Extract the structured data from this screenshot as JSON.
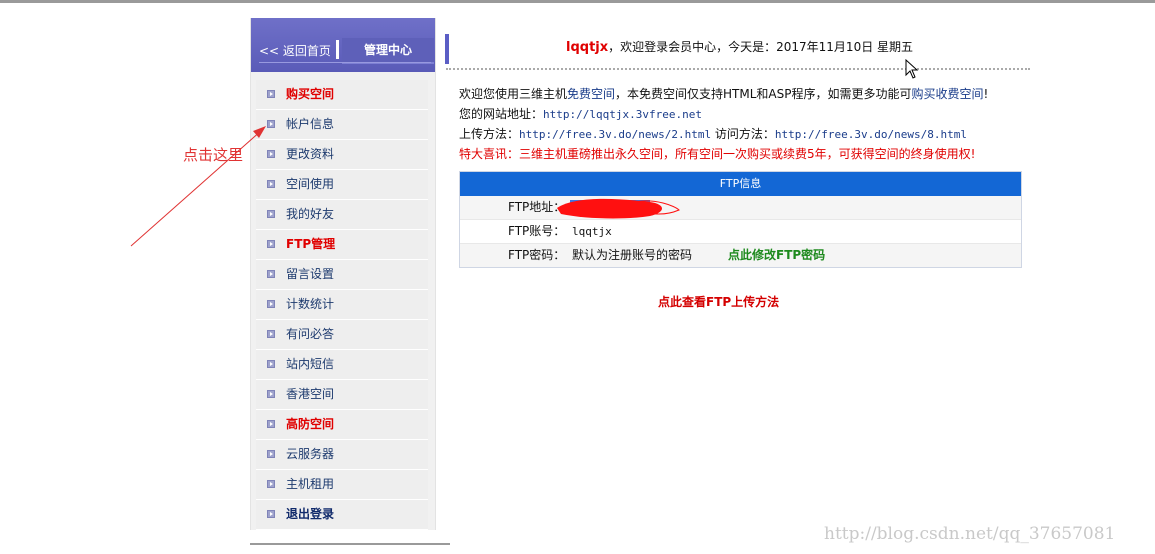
{
  "sidebar": {
    "back_label": "<< 返回首页",
    "title": "管理中心",
    "items": [
      {
        "label": "购买空间",
        "style": "red"
      },
      {
        "label": "帐户信息",
        "style": "normal"
      },
      {
        "label": "更改资料",
        "style": "normal"
      },
      {
        "label": "空间使用",
        "style": "normal"
      },
      {
        "label": "我的好友",
        "style": "normal"
      },
      {
        "label": "FTP管理",
        "style": "red"
      },
      {
        "label": "留言设置",
        "style": "normal"
      },
      {
        "label": "计数统计",
        "style": "normal"
      },
      {
        "label": "有问必答",
        "style": "normal"
      },
      {
        "label": "站内短信",
        "style": "normal"
      },
      {
        "label": "香港空间",
        "style": "normal"
      },
      {
        "label": "高防空间",
        "style": "red"
      },
      {
        "label": "云服务器",
        "style": "normal"
      },
      {
        "label": "主机租用",
        "style": "normal"
      },
      {
        "label": "退出登录",
        "style": "navy"
      }
    ]
  },
  "annotation": {
    "text": "点击这里",
    "color": "#e03333"
  },
  "header": {
    "username": "lqqtjx",
    "welcome_text": "，欢迎登录会员中心，今天是：2017年11月10日 星期五"
  },
  "info": {
    "line1_prefix": "欢迎您使用三维主机",
    "line1_link1": "免费空间",
    "line1_middle": "，本免费空间仅支持HTML和ASP程序，如需更多功能可",
    "line1_link2": "购买收费空间",
    "line1_suffix": "!",
    "site_label": "您的网站地址：",
    "site_url": "http://lqqtjx.3vfree.net",
    "upload_label": "上传方法：",
    "upload_url": "http://free.3v.do/news/2.html",
    "visit_label": "访问方法：",
    "visit_url": "http://free.3v.do/news/8.html",
    "notice": "特大喜讯：三维主机重磅推出永久空间，所有空间一次购买或续费5年，可获得空间的终身使用权!"
  },
  "ftp": {
    "header": "FTP信息",
    "address_label": "FTP地址：",
    "account_label": "FTP账号：",
    "account_value": "lqqtjx",
    "password_label": "FTP密码：",
    "password_value": "默认为注册账号的密码",
    "change_password_link": "点此修改FTP密码"
  },
  "ftp_method_link": "点此查看FTP上传方法",
  "watermark": "http://blog.csdn.net/qq_37657081",
  "colors": {
    "sidebar_header": "#5e60b9",
    "ftp_header": "#1367d5",
    "emphasis_red": "#e00000",
    "link_blue": "#1a3c8a",
    "link_green": "#1e8a1e"
  }
}
